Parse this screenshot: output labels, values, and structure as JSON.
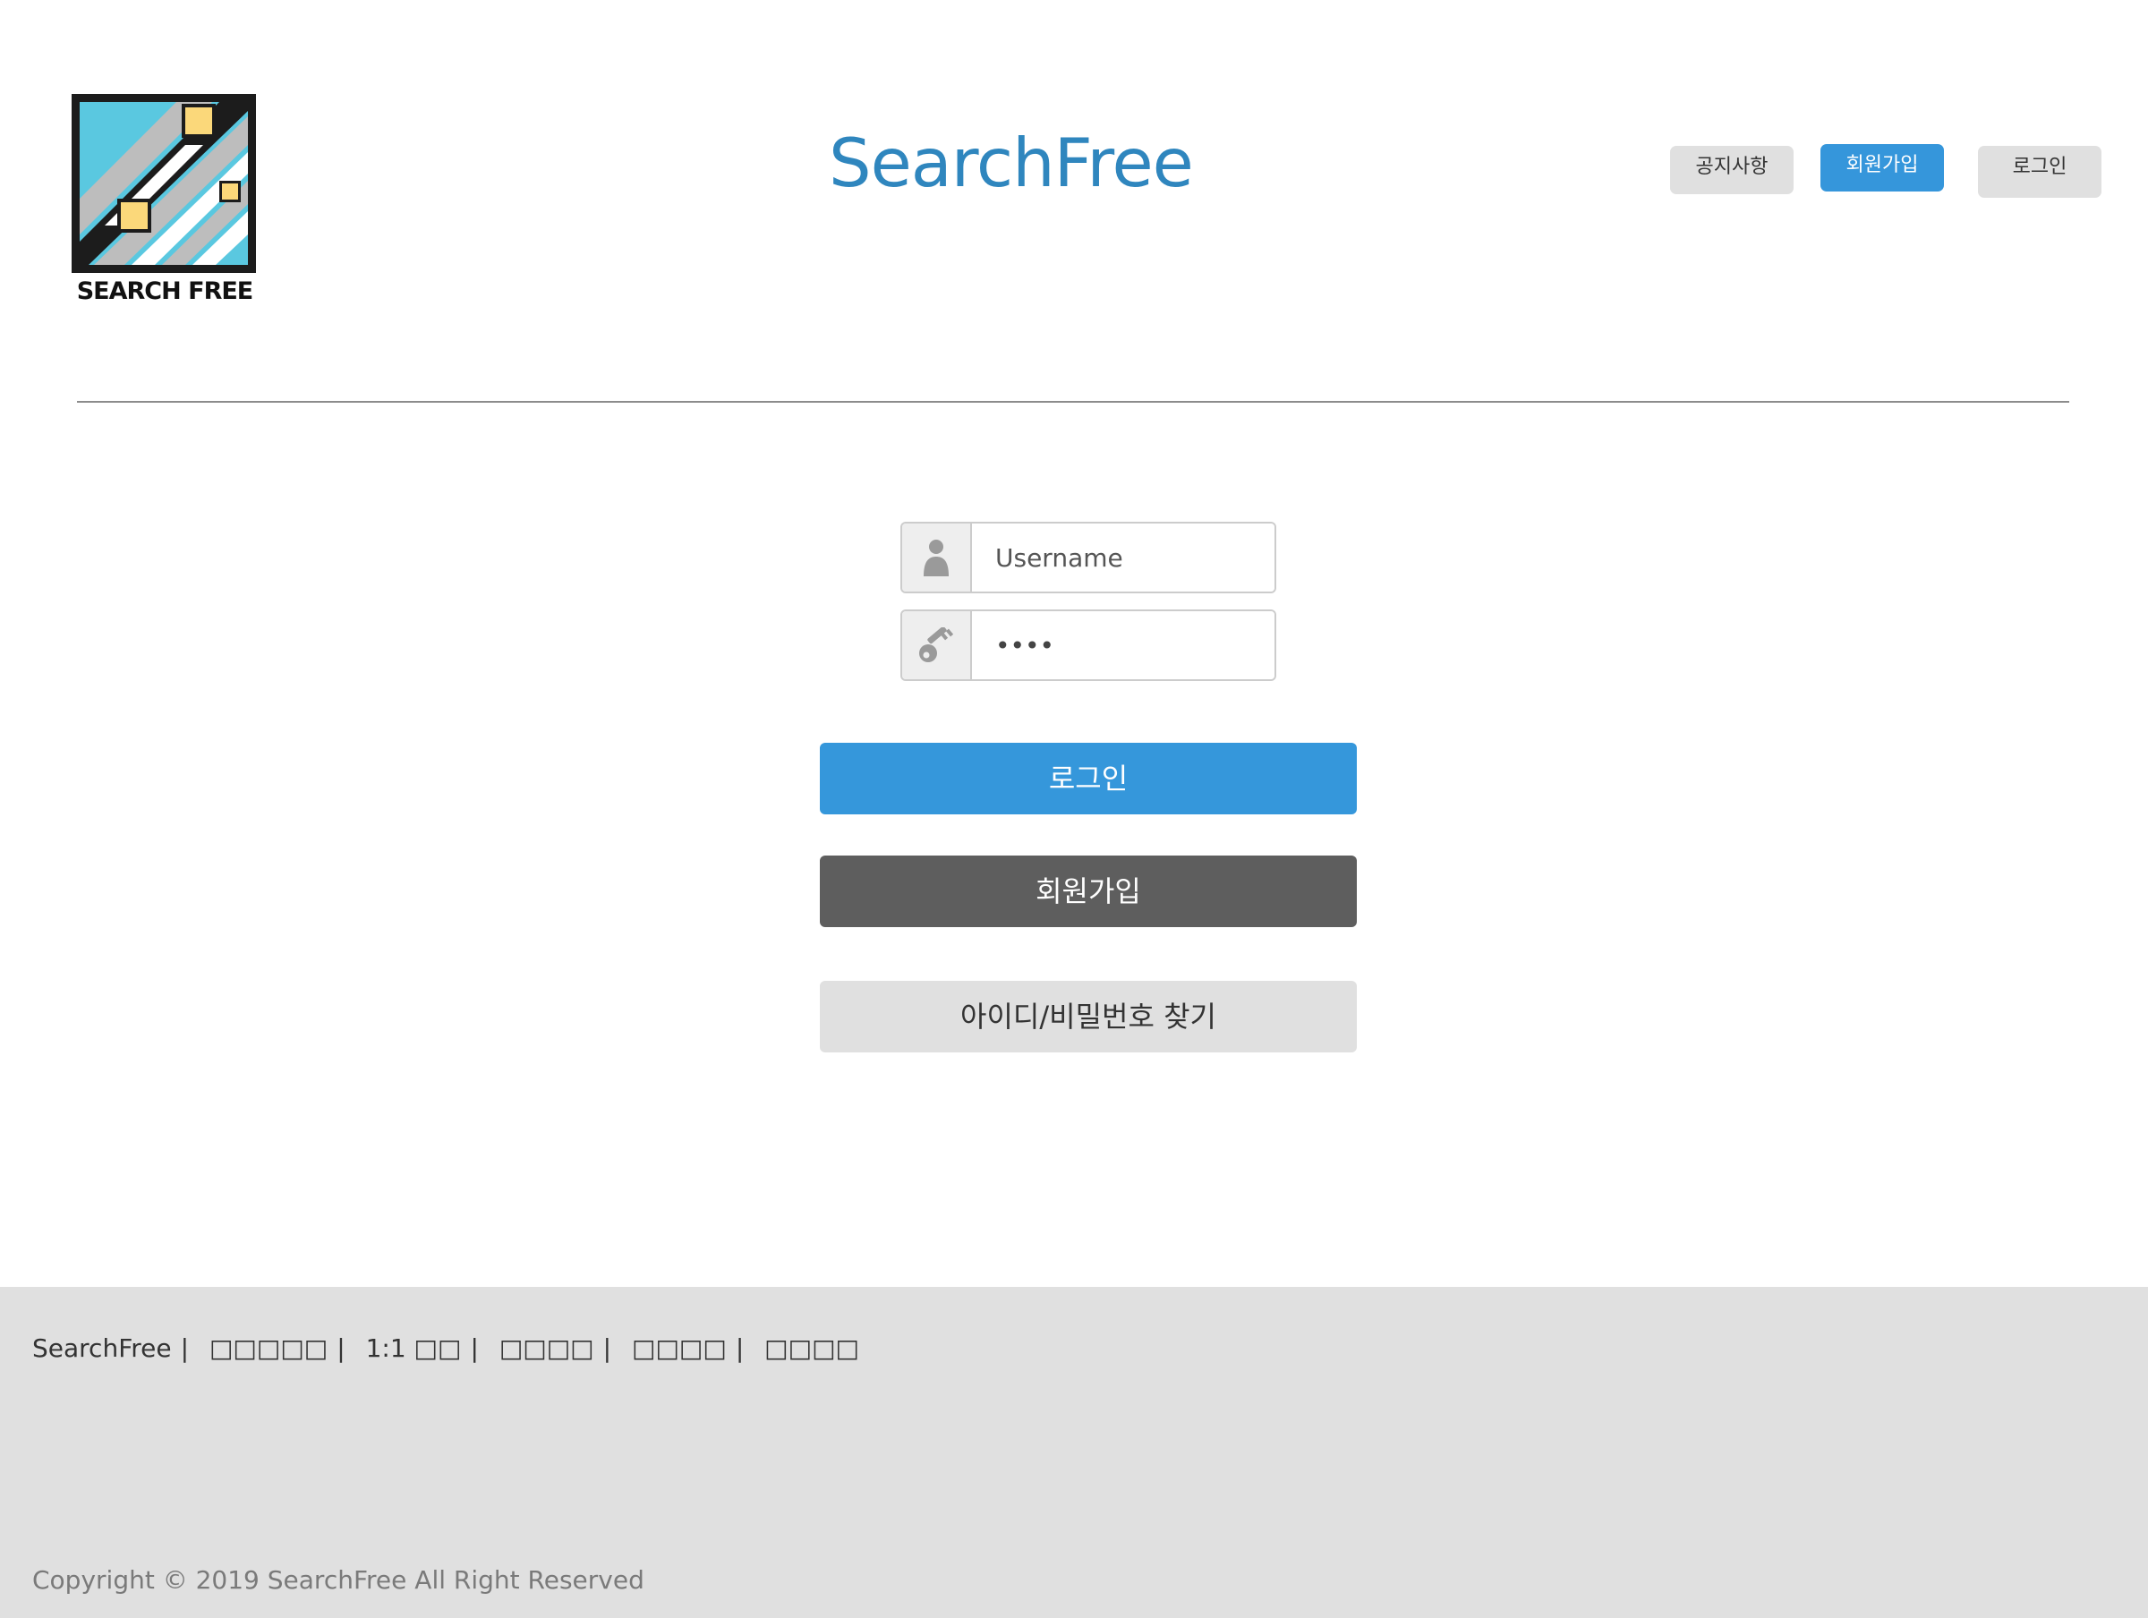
{
  "header": {
    "logo_text": "SEARCH FREE",
    "site_title": "SearchFree",
    "nav": [
      {
        "label": "공지사항"
      },
      {
        "label": "회원가입"
      },
      {
        "label": "로그인"
      }
    ]
  },
  "form": {
    "username": {
      "placeholder": "Username",
      "value": ""
    },
    "password": {
      "value": "••••"
    },
    "login_label": "로그인",
    "signup_label": "회원가입",
    "find_label": "아이디/비밀번호 찾기"
  },
  "footer": {
    "brand": "SearchFree",
    "links": [
      "□□□□□",
      "1:1 □□",
      "□□□□",
      "□□□□",
      "□□□□"
    ],
    "copyright": "Copyright © 2019 SearchFree All Right Reserved"
  },
  "colors": {
    "title": "#2f86be",
    "primary_button": "#3597db",
    "secondary_button": "#5e5e5e",
    "light_button": "#e0e0e0",
    "footer_bg": "#e0e0e0"
  },
  "icons": {
    "username_addon": "user-icon",
    "password_addon": "key-icon"
  }
}
